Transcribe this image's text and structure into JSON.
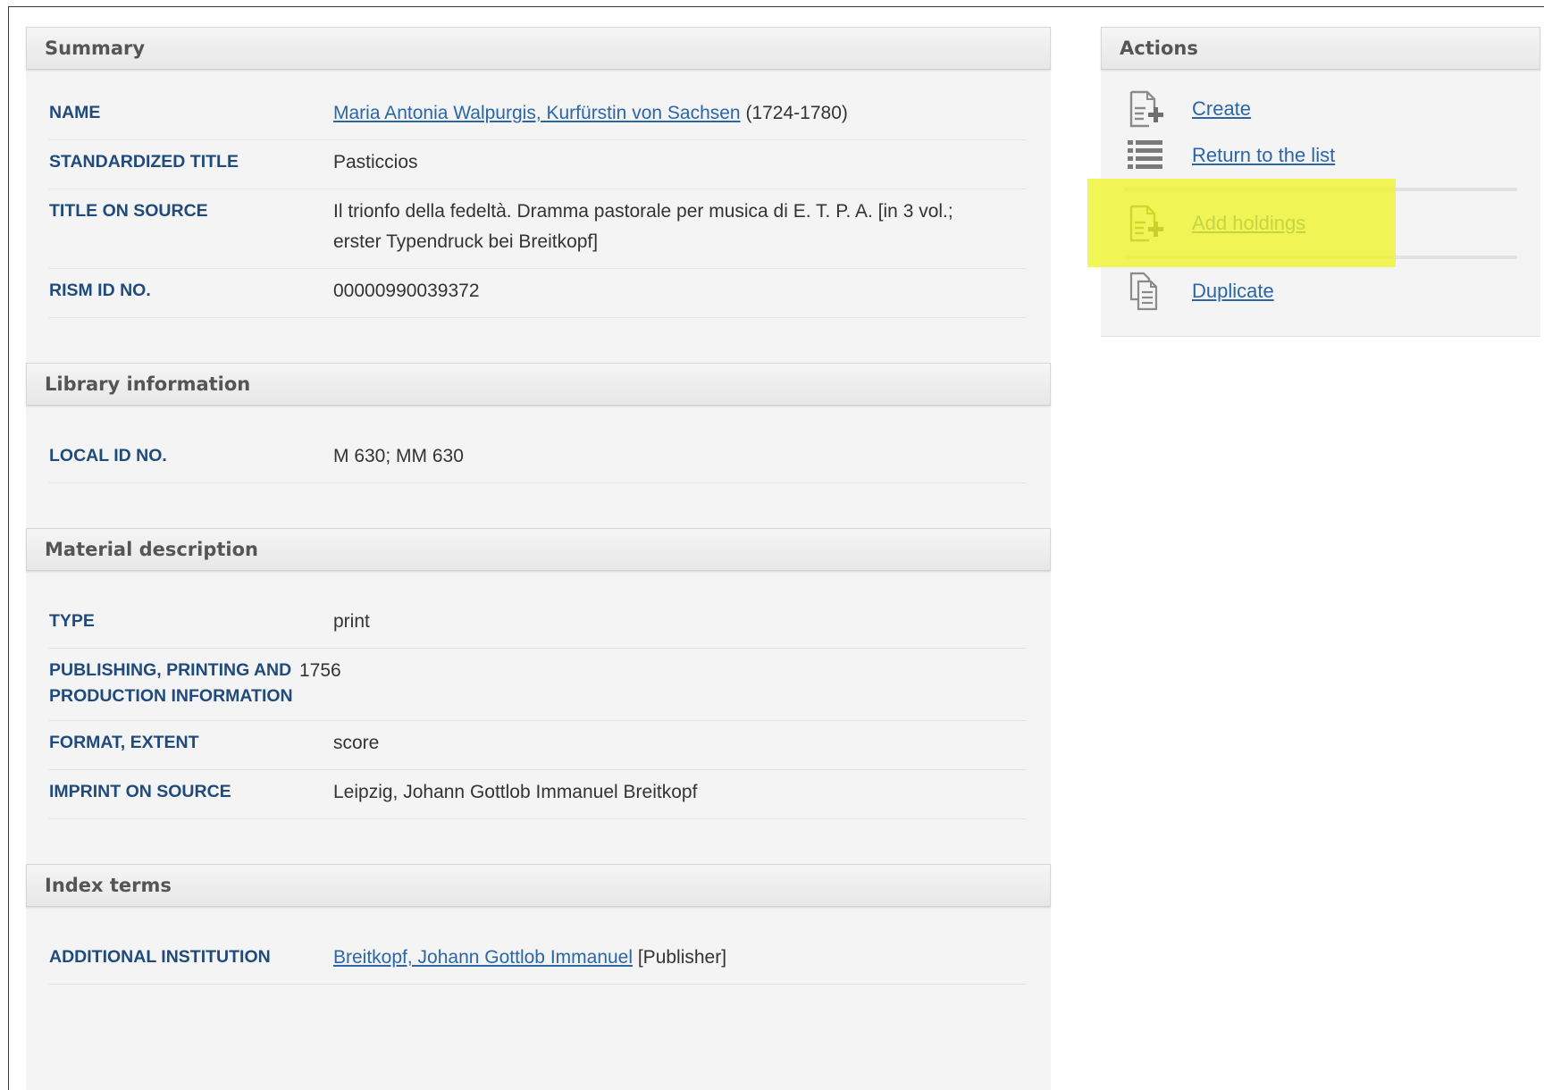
{
  "summary": {
    "title": "Summary",
    "rows": [
      {
        "label": "NAME",
        "link": "Maria Antonia Walpurgis, Kurfürstin von Sachsen",
        "suffix": " (1724-1780)"
      },
      {
        "label": "STANDARDIZED TITLE",
        "value": "Pasticcios"
      },
      {
        "label": "TITLE ON SOURCE",
        "value": "Il trionfo della fedeltà. Dramma pastorale per musica di E. T. P. A. [in 3 vol.; erster Typendruck bei Breitkopf]"
      },
      {
        "label": "RISM ID NO.",
        "value": "00000990039372"
      }
    ]
  },
  "library": {
    "title": "Library information",
    "rows": [
      {
        "label": "LOCAL ID NO.",
        "value": "M 630; MM 630"
      }
    ]
  },
  "material": {
    "title": "Material description",
    "rows": [
      {
        "label": "TYPE",
        "value": "print"
      },
      {
        "label": "PUBLISHING, PRINTING AND PRODUCTION INFORMATION",
        "value": "1756"
      },
      {
        "label": "FORMAT, EXTENT",
        "value": "score"
      },
      {
        "label": "IMPRINT ON SOURCE",
        "value": "Leipzig, Johann Gottlob Immanuel Breitkopf"
      }
    ]
  },
  "index": {
    "title": "Index terms",
    "rows": [
      {
        "label": "ADDITIONAL INSTITUTION",
        "link": "Breitkopf, Johann Gottlob Immanuel",
        "suffix": " [Publisher]"
      }
    ]
  },
  "actions": {
    "title": "Actions",
    "items": [
      {
        "label": "Create",
        "icon": "document-add-icon"
      },
      {
        "label": "Return to the list",
        "icon": "list-icon"
      },
      {
        "label": "Add holdings",
        "icon": "document-add-icon"
      },
      {
        "label": "Duplicate",
        "icon": "copy-icon"
      }
    ]
  },
  "colors": {
    "label": "#1f4b7c",
    "link": "#2a66a8",
    "highlight": "#eef528"
  }
}
